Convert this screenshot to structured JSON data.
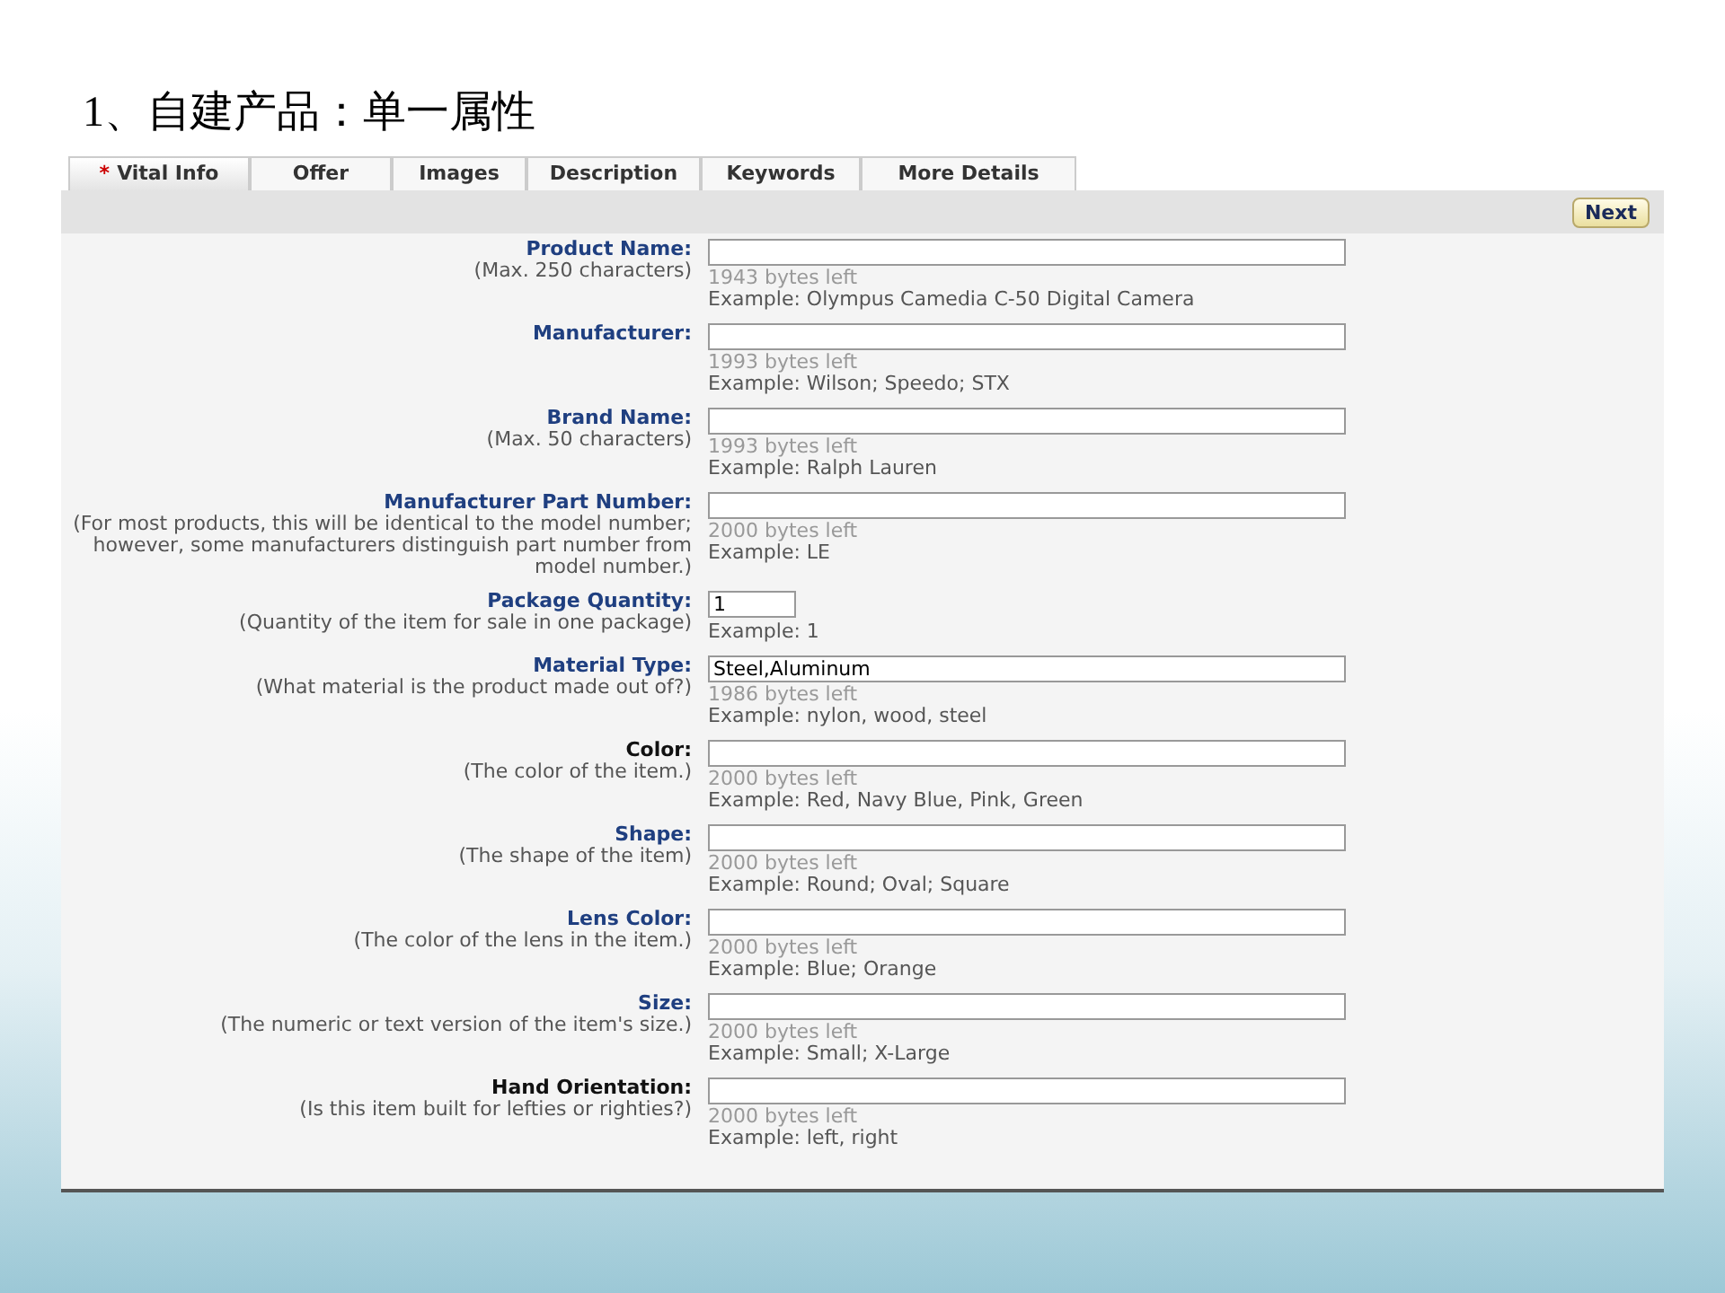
{
  "heading": "1、自建产品：单一属性",
  "tabs": [
    {
      "label": "Vital Info",
      "required_mark": "*",
      "selected": true
    },
    {
      "label": "Offer",
      "selected": false
    },
    {
      "label": "Images",
      "selected": false
    },
    {
      "label": "Description",
      "selected": false
    },
    {
      "label": "Keywords",
      "selected": false
    },
    {
      "label": "More Details",
      "selected": false
    }
  ],
  "next_button": "Next",
  "fields": [
    {
      "label": "Product Name:",
      "highlighted": true,
      "note": "(Max. 250 characters)",
      "kind": "long",
      "counter": "1943 bytes left",
      "example": "Example: Olympus Camedia C-50 Digital Camera"
    },
    {
      "label": "Manufacturer:",
      "highlighted": true,
      "kind": "long",
      "counter": "1993 bytes left",
      "example": "Example: Wilson; Speedo; STX"
    },
    {
      "label": "Brand Name:",
      "highlighted": true,
      "note": "(Max. 50 characters)",
      "kind": "long",
      "counter": "1993 bytes left",
      "example": "Example: Ralph Lauren"
    },
    {
      "label": "Manufacturer Part Number:",
      "highlighted": true,
      "note": "(For most products, this will be identical to the model number; however, some manufacturers distinguish part number from model number.)",
      "kind": "long",
      "counter": "2000 bytes left",
      "example": "Example: LE"
    },
    {
      "label": "Package Quantity:",
      "highlighted": true,
      "note": "(Quantity of the item for sale in one package)",
      "kind": "short",
      "value": "1",
      "example": "Example: 1"
    },
    {
      "label": "Material Type:",
      "highlighted": true,
      "note": "(What material is the product made out of?)",
      "kind": "long",
      "value": "Steel,Aluminum",
      "counter": "1986 bytes left",
      "example": "Example: nylon, wood, steel"
    },
    {
      "label": "Color:",
      "highlighted": false,
      "note": "(The color of the item.)",
      "kind": "long",
      "counter": "2000 bytes left",
      "example": "Example: Red, Navy Blue, Pink, Green"
    },
    {
      "label": "Shape:",
      "highlighted": true,
      "note": "(The shape of the item)",
      "kind": "long",
      "counter": "2000 bytes left",
      "example": "Example: Round; Oval; Square"
    },
    {
      "label": "Lens Color:",
      "highlighted": true,
      "note": "(The color of the lens in the item.)",
      "kind": "long",
      "counter": "2000 bytes left",
      "example": "Example: Blue; Orange"
    },
    {
      "label": "Size:",
      "highlighted": true,
      "note": "(The numeric or text version of the item's size.)",
      "kind": "long",
      "counter": "2000 bytes left",
      "example": "Example: Small; X-Large"
    },
    {
      "label": "Hand Orientation:",
      "highlighted": false,
      "note": "(Is this item built for lefties or righties?)",
      "kind": "long",
      "counter": "2000 bytes left",
      "example": "Example: left, right"
    }
  ]
}
